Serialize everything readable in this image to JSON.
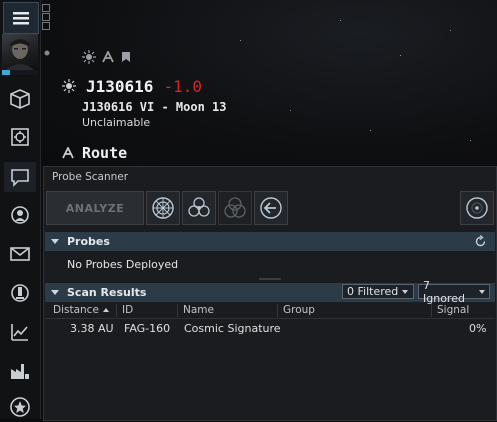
{
  "location": {
    "system_name": "J130616",
    "security_status": "-1.0",
    "detail": "J130616 VI - Moon 13",
    "sovereignty": "Unclaimable",
    "route_label": "Route"
  },
  "probe_scanner": {
    "title": "Probe Scanner",
    "analyze_label": "ANALYZE",
    "probes_section": {
      "label": "Probes",
      "empty_text": "No Probes Deployed"
    },
    "results_section": {
      "label": "Scan Results",
      "filtered_label": "0 Filtered",
      "ignored_label": "7 Ignored"
    },
    "columns": [
      "Distance",
      "ID",
      "Name",
      "Group",
      "Signal"
    ],
    "results": [
      {
        "distance": "3.38 AU",
        "id": "FAG-160",
        "name": "Cosmic Signature",
        "group": "",
        "signal": "0%"
      }
    ]
  },
  "colors": {
    "security_negative": "#e02020",
    "section_header": "#2b3b48",
    "accent_blue": "#3fa6d8"
  },
  "icons": {
    "neocom": [
      "menu-icon",
      "inventory-icon",
      "fitting-icon",
      "chat-icon",
      "people-icon",
      "mail-icon",
      "industry-icon",
      "market-icon",
      "factory-icon",
      "agency-icon"
    ],
    "toolbar": [
      "formation-sphere-icon",
      "formation-pinpoint-icon",
      "formation-spread-icon",
      "return-probes-icon",
      "map-view-icon"
    ],
    "location": [
      "sun-icon",
      "autopilot-icon",
      "bookmark-icon"
    ]
  }
}
